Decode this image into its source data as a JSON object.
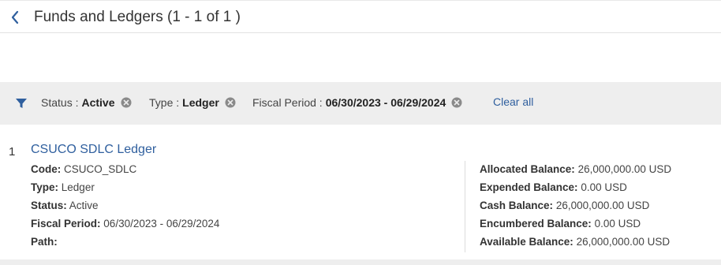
{
  "header": {
    "title": "Funds and Ledgers (1 - 1 of 1 )"
  },
  "filters": {
    "items": [
      {
        "label": "Status :",
        "value": "Active"
      },
      {
        "label": "Type :",
        "value": "Ledger"
      },
      {
        "label": "Fiscal Period :",
        "value": "06/30/2023 - 06/29/2024"
      }
    ],
    "clear_all": "Clear all"
  },
  "result": {
    "index": "1",
    "title": "CSUCO SDLC Ledger",
    "left_fields": [
      {
        "label": "Code:",
        "value": "CSUCO_SDLC"
      },
      {
        "label": "Type:",
        "value": "Ledger"
      },
      {
        "label": "Status:",
        "value": "Active"
      },
      {
        "label": "Fiscal Period:",
        "value": "06/30/2023 - 06/29/2024"
      },
      {
        "label": "Path:",
        "value": ""
      }
    ],
    "right_fields": [
      {
        "label": "Allocated Balance:",
        "value": "26,000,000.00 USD"
      },
      {
        "label": "Expended Balance:",
        "value": "0.00 USD"
      },
      {
        "label": "Cash Balance:",
        "value": "26,000,000.00 USD"
      },
      {
        "label": "Encumbered Balance:",
        "value": "0.00 USD"
      },
      {
        "label": "Available Balance:",
        "value": "26,000,000.00 USD"
      }
    ]
  },
  "colors": {
    "link": "#2f5f9e",
    "filter_bar": "#eeeeee",
    "filter_icon": "#2f5f9e"
  }
}
